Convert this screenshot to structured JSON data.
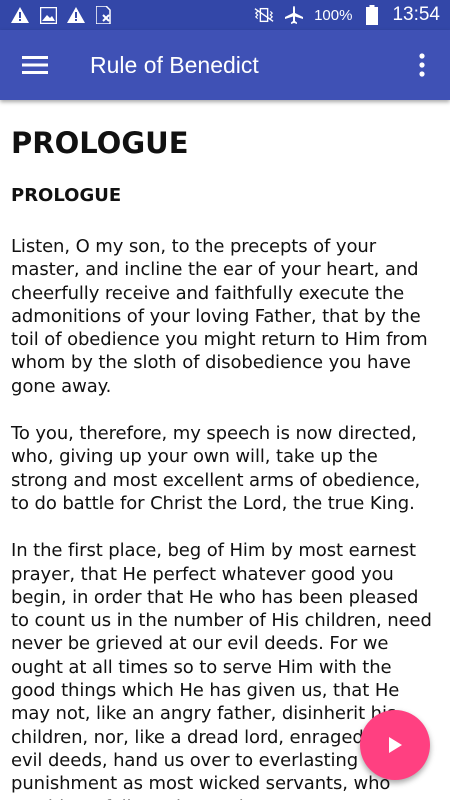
{
  "status_bar": {
    "icons_left": [
      "warning-icon",
      "image-icon",
      "warning-icon",
      "sim-error-icon"
    ],
    "icons_right": [
      "vibrate-icon",
      "airplane-icon",
      "battery-icon"
    ],
    "battery": "100%",
    "time": "13:54"
  },
  "app_bar": {
    "title": "Rule of Benedict",
    "color": "#3f51b5"
  },
  "content": {
    "heading": "PROLOGUE",
    "section_heading": "PROLOGUE",
    "paragraphs": [
      "Listen, O my son, to the precepts of your master, and incline the ear of your heart, and cheerfully receive and faithfully execute the admonitions of your loving Father, that by the toil of obedience you might return to Him from whom by the sloth of disobedience you have gone away.",
      "To you, therefore, my speech is now directed, who, giving up your own will, take up the strong and most excellent arms of obedience, to do battle for Christ the Lord, the true King.",
      "In the first place, beg of Him by most earnest prayer, that He perfect whatever good you begin, in order that He who has been pleased to count us in the number of His children, need never be grieved at our evil deeds. For we ought at all times so to serve Him with the good things which He has given us, that He may not, like an angry father, disinherit his children, nor, like a dread lord, enraged at our evil deeds, hand us over to everlasting punishment as most wicked servants, who would not follow Him to glory."
    ]
  },
  "fab": {
    "icon": "play-icon",
    "color": "#ff4081"
  }
}
